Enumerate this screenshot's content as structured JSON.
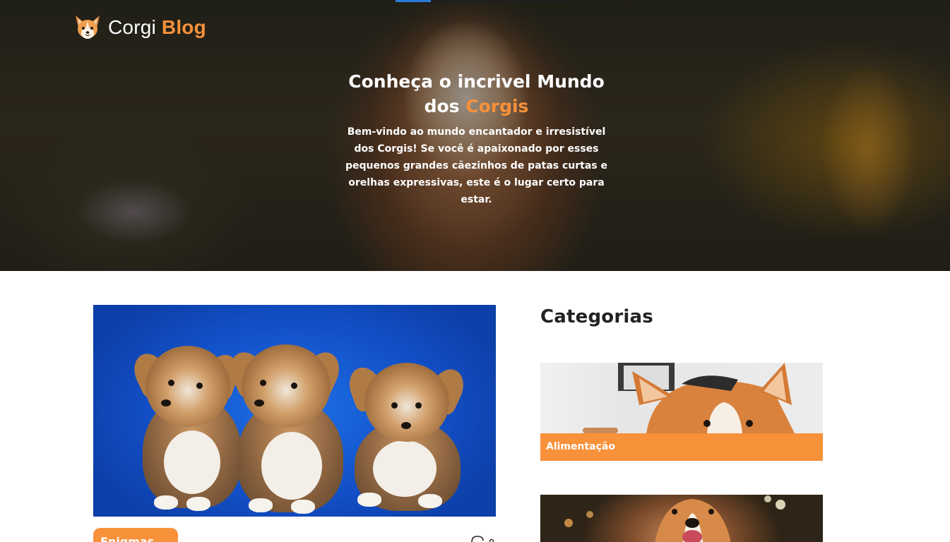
{
  "header": {
    "logo_text_main": "Corgi",
    "logo_text_accent": "Blog",
    "logo_icon": "corgi-face-icon"
  },
  "hero": {
    "title_line1": "Conheça o incrivel Mundo",
    "title_line2_prefix": "dos",
    "title_line2_accent": "Corgis",
    "description": "Bem-vindo ao mundo encantador e irresistível dos Corgis! Se você é apaixonado por esses pequenos grandes cãezinhos de patas curtas e orelhas expressivas, este é o lugar certo para estar."
  },
  "post": {
    "tag_label": "Enigmas",
    "icon": "comment-icon"
  },
  "sidebar": {
    "title": "Categorias",
    "categories": [
      {
        "label": "Alimentação"
      },
      {
        "label": ""
      }
    ]
  },
  "colors": {
    "accent": "#f7913a",
    "text_dark": "#222222",
    "white": "#ffffff"
  }
}
